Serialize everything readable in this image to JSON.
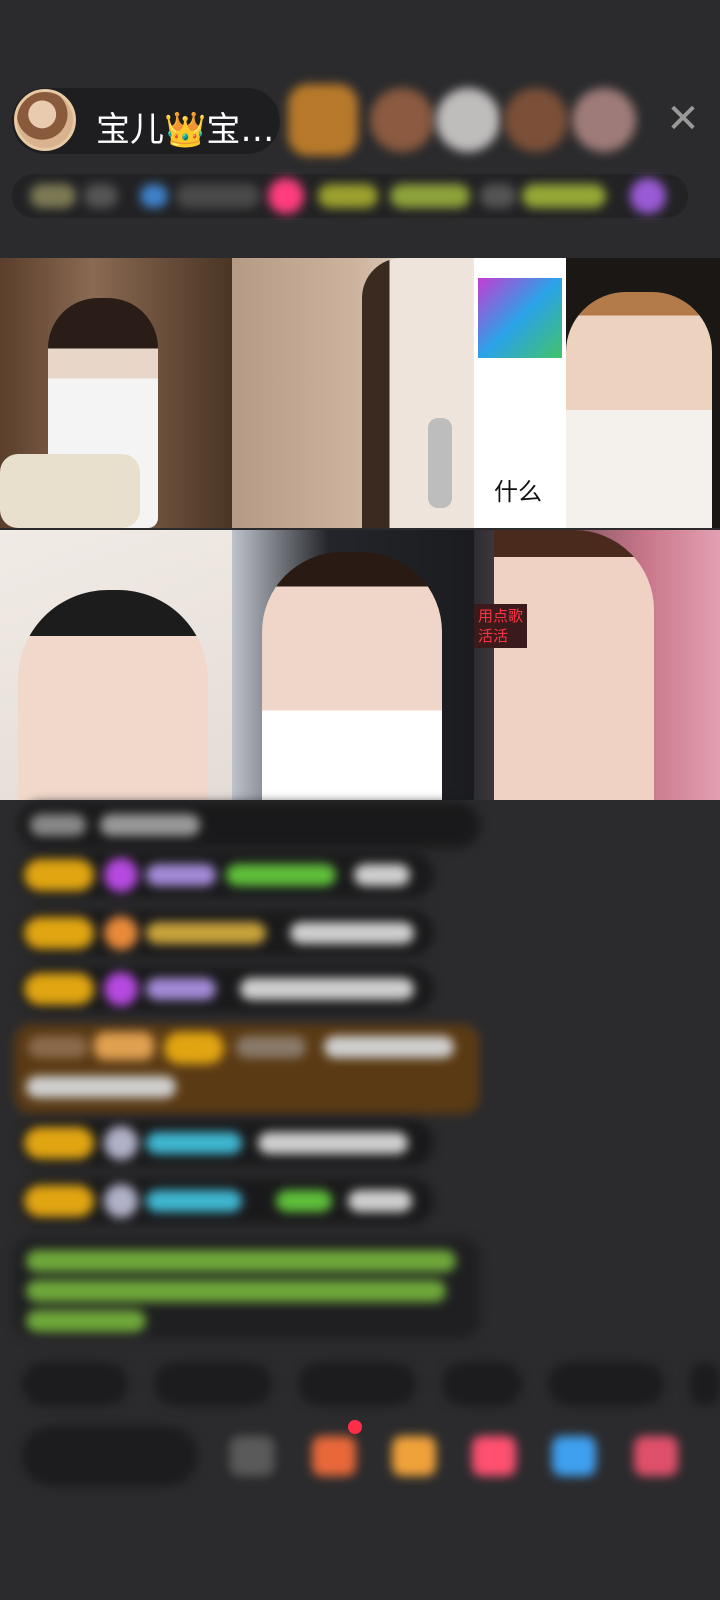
{
  "header": {
    "host_name": "宝儿👑宝…",
    "close_symbol": "✕"
  },
  "video_grid": {
    "tile_caption": "用点歌\n活活",
    "tile_sign_text": "什么"
  },
  "colors": {
    "background": "#2b2b2d",
    "badge_gold": "#e1a512",
    "accent_pink": "#ff3d7f",
    "green_text": "#5fbf3a",
    "cyan_name": "#3fb6d0",
    "highlight_row": "#5a3a14"
  },
  "icons": {
    "close": "close-icon",
    "gift": "gift-icon",
    "emoji": "emoji-icon",
    "more": "more-icon"
  }
}
